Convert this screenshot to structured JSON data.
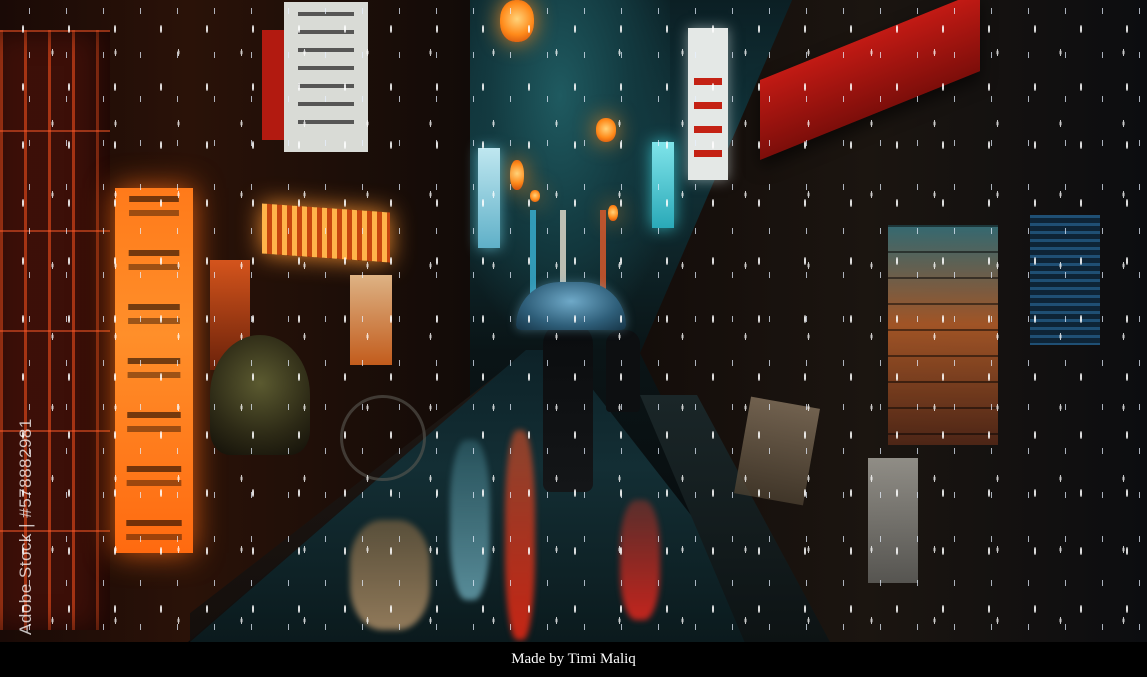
{
  "photo": {
    "watermark_text": "Adobe Stock | #578882981"
  },
  "caption": {
    "text": "Made by Timi Maliq"
  }
}
